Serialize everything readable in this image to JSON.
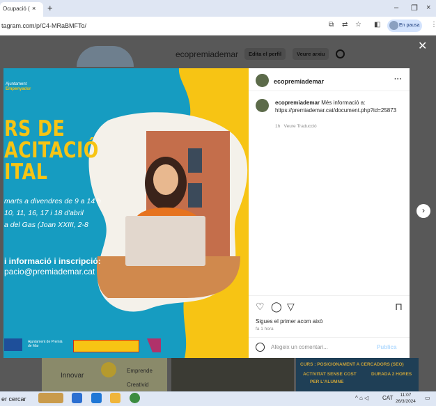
{
  "browser": {
    "tab_title": "Ocupació (",
    "tab_close": "×",
    "new_tab": "+",
    "url": "tagram.com/p/C4-MRaBMFTo/",
    "profile_status": "En pausa",
    "window_controls": [
      "–",
      "❐",
      "×"
    ]
  },
  "background_profile": {
    "username": "ecopremiademar",
    "edit_profile_label": "Edita el perfil",
    "archive_label": "Veure arxiu"
  },
  "post": {
    "author": "ecopremiademar",
    "caption_user": "ecopremiademar",
    "caption_text": "Més informació a: https://premiademar.cat/document.php?id=25873",
    "caption_age": "1h",
    "translate_label": "Veure Traducció",
    "likes_text": "Sigues el primer acom això",
    "time_ago": "fa 1 hora",
    "comment_placeholder": "Afegeix un comentari...",
    "publish_label": "Publica"
  },
  "poster": {
    "logo_line1": "Ajuntament",
    "logo_line2": "Empenyador",
    "title_lines": [
      "RS DE",
      "ACITACIÓ",
      "ITAL"
    ],
    "schedule_lines": [
      "marts a divendres de 9 a 14 h",
      "10, 11, 16, 17 i 18 d'abril",
      "a del Gas (Joan XXIII, 2-8"
    ],
    "info_heading": "i informació i inscripció:",
    "email": "pacio@premiademar.cat",
    "footer_logo1": "Ajuntament de Premià de Mar"
  },
  "background_posts": {
    "post1_text": [
      "Innovar",
      "Emprende",
      "Creativid"
    ],
    "post3_text": [
      "CURS : POSICIONAMENT A CERCADORS (SEO)",
      "ACTIVITAT SENSE COST",
      "PER L'ALUMNE",
      "DURADA 2 HORES"
    ]
  },
  "taskbar": {
    "search": "er cercar",
    "lang": "CAT",
    "time": "11:07",
    "date": "26/3/2024"
  },
  "colors": {
    "poster_blue": "#169cc1",
    "poster_yellow": "#f7c414",
    "instagram_blue": "#0095f6"
  }
}
